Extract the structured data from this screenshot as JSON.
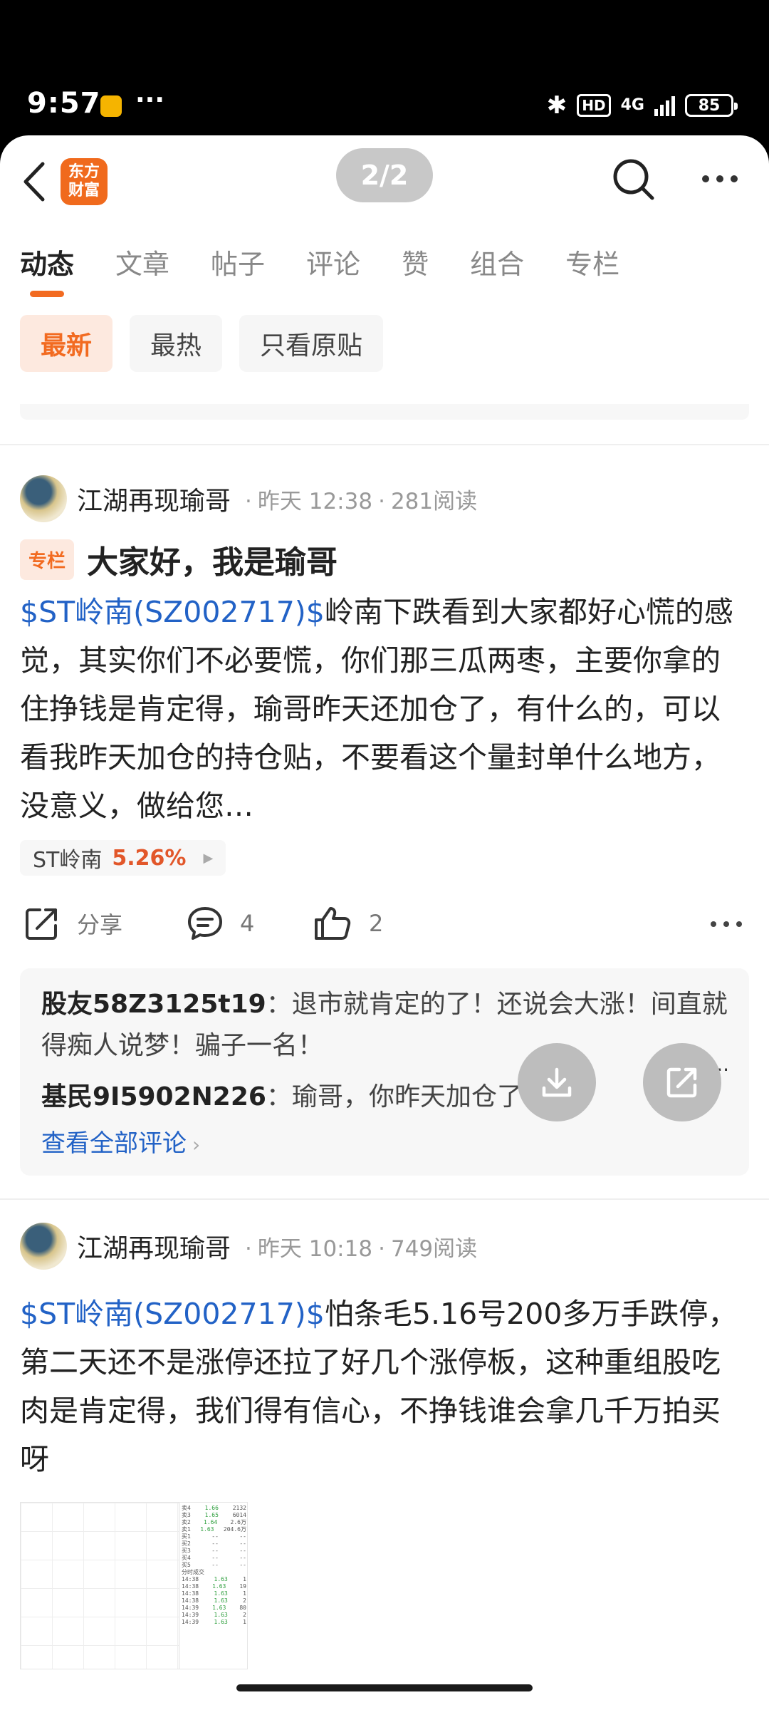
{
  "status_bar": {
    "time": "9:57",
    "more": "···",
    "hd": "HD",
    "network": "4G",
    "battery": "85"
  },
  "nav": {
    "logo_line1": "东方",
    "logo_line2": "财富",
    "pager": "2/2"
  },
  "tabs": [
    "动态",
    "文章",
    "帖子",
    "评论",
    "赞",
    "组合",
    "专栏"
  ],
  "filters": [
    "最新",
    "最热",
    "只看原贴"
  ],
  "post1": {
    "author": "江湖再现瑜哥",
    "time": "昨天 12:38",
    "reads": "281阅读",
    "badge": "专栏",
    "title": "大家好，我是瑜哥",
    "stock_link": "$ST岭南(SZ002717)$",
    "body": "岭南下跌看到大家都好心慌的感觉，其实你们不必要慌，你们那三瓜两枣，主要你拿的住挣钱是肯定得，瑜哥昨天还加仓了，有什么的，可以看我昨天加仓的持仓贴，不要看这个量封单什么地方，没意义，做给您…",
    "stock_tag": {
      "name": "ST岭南",
      "pct": "5.26%"
    },
    "share_label": "分享",
    "comment_count": "4",
    "like_count": "2",
    "comments": [
      {
        "name": "股友58Z3125t19",
        "text": "退市就肯定的了！还说会大涨！间直就得痴人说梦！骗子一名！"
      },
      {
        "name": "基民9I5902N226",
        "text": "瑜哥，你昨天加仓了?"
      }
    ],
    "see_all": "查看全部评论"
  },
  "post2": {
    "author": "江湖再现瑜哥",
    "time": "昨天 10:18",
    "reads": "749阅读",
    "stock_link": "$ST岭南(SZ002717)$",
    "body": "怕条毛5.16号200多万手跌停，第二天还不是涨停还拉了好几个涨停板，这种重组股吃肉是肯定得，我们得有信心，不挣钱谁会拿几千万拍买呀",
    "thumb_rows": [
      [
        "卖4",
        "1.66",
        "2132"
      ],
      [
        "卖3",
        "1.65",
        "6014"
      ],
      [
        "卖2",
        "1.64",
        "2.6万"
      ],
      [
        "卖1",
        "1.63",
        "204.6万"
      ],
      [
        "买1",
        "--",
        "--"
      ],
      [
        "买2",
        "--",
        "--"
      ],
      [
        "买3",
        "--",
        "--"
      ],
      [
        "买4",
        "--",
        "--"
      ],
      [
        "买5",
        "--",
        "--"
      ],
      [
        "分时成交",
        "",
        ""
      ],
      [
        "14:38",
        "1.63",
        "1"
      ],
      [
        "14:38",
        "1.63",
        "19"
      ],
      [
        "14:38",
        "1.63",
        "1"
      ],
      [
        "14:38",
        "1.63",
        "2"
      ],
      [
        "14:39",
        "1.63",
        "80"
      ],
      [
        "14:39",
        "1.63",
        "2"
      ],
      [
        "14:39",
        "1.63",
        "1"
      ]
    ]
  }
}
